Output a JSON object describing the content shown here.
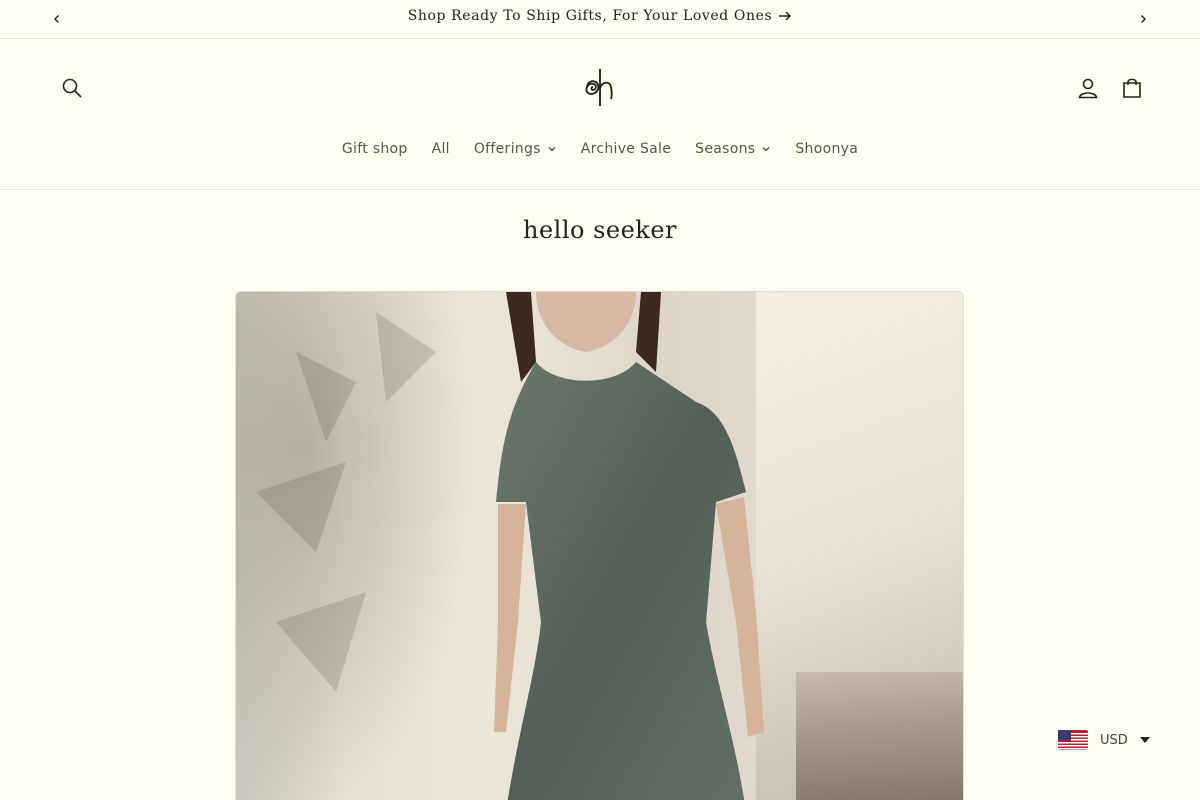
{
  "announcement": {
    "text": "Shop Ready To Ship Gifts, For Your Loved Ones"
  },
  "header": {
    "nav": [
      {
        "label": "Gift shop",
        "has_dropdown": false
      },
      {
        "label": "All",
        "has_dropdown": false
      },
      {
        "label": "Offerings",
        "has_dropdown": true
      },
      {
        "label": "Archive Sale",
        "has_dropdown": false
      },
      {
        "label": "Seasons",
        "has_dropdown": true
      },
      {
        "label": "Shoonya",
        "has_dropdown": false
      }
    ]
  },
  "main": {
    "title": "hello seeker"
  },
  "currency": {
    "code": "USD",
    "flag": "us-flag-icon"
  },
  "colors": {
    "background": "#fffff2",
    "text": "#222222",
    "nav_text": "#555555"
  }
}
